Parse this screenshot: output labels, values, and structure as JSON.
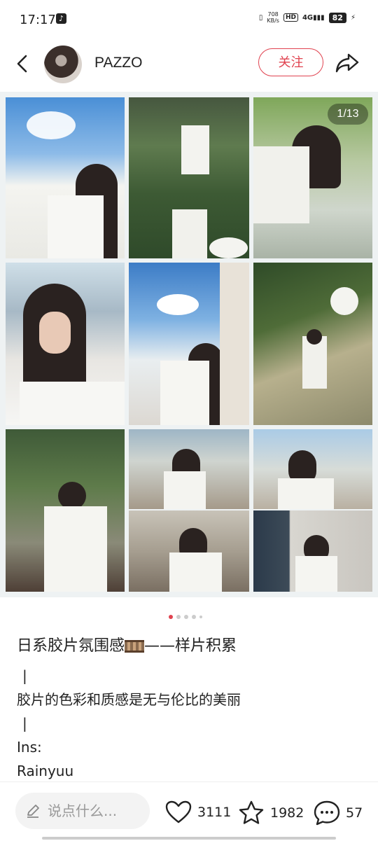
{
  "status_bar": {
    "time": "17:17",
    "net_speed_value": "708",
    "net_speed_unit": "KB/s",
    "hd": "HD",
    "network": "4G",
    "battery": "82"
  },
  "header": {
    "username": "PAZZO",
    "follow_label": "关注"
  },
  "gallery": {
    "counter": "1/13",
    "page_dots": 5,
    "active_dot": 0
  },
  "post": {
    "title": "日系胶片氛围感",
    "title_suffix": "——样片积累",
    "sep1": "|",
    "line1": "胶片的色彩和质感是无与伦比的美丽",
    "sep2": "|",
    "line2": "Ins:",
    "line3": "Rainyuu"
  },
  "bottom_bar": {
    "comment_placeholder": "说点什么...",
    "likes": "3111",
    "favorites": "1982",
    "comments": "57"
  },
  "colors": {
    "accent": "#e0424f"
  }
}
